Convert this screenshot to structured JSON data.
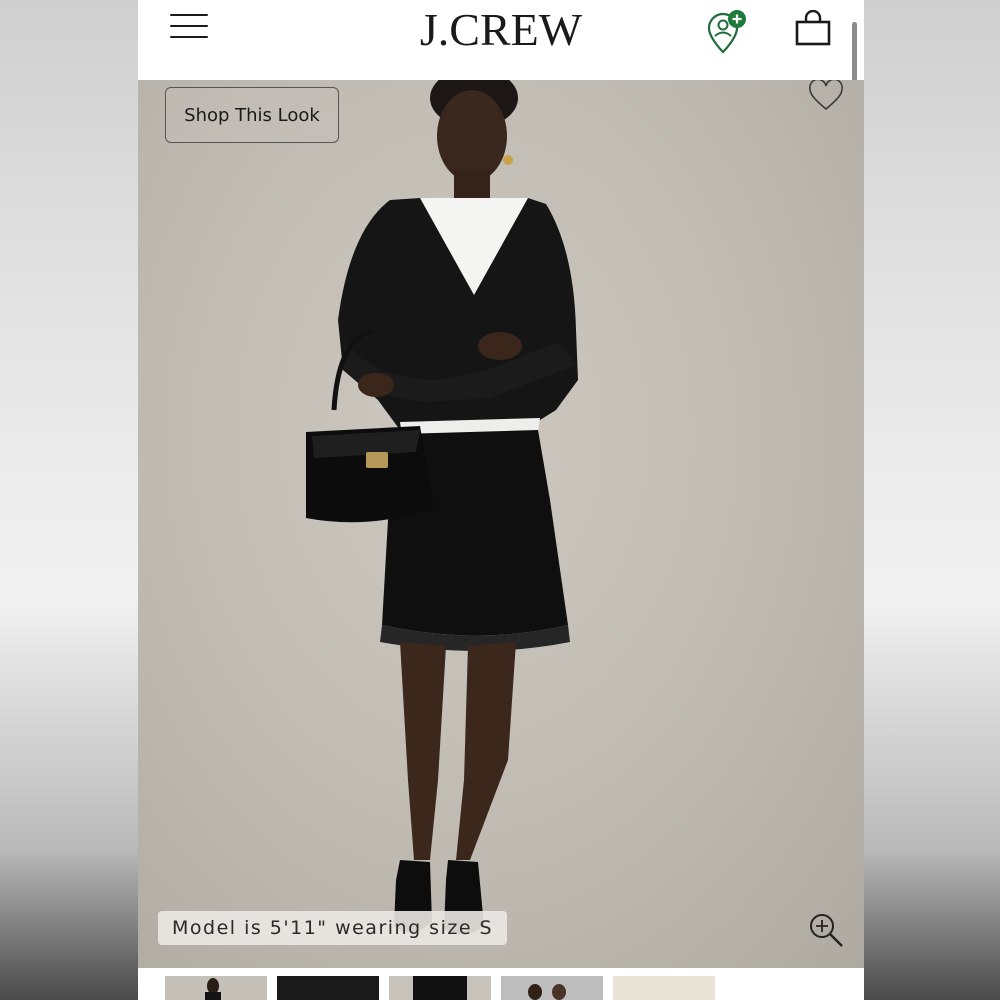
{
  "header": {
    "logo_text": "J.CREW",
    "menu_icon": "hamburger-menu-icon",
    "account_icon": "account-add-icon",
    "bag_icon": "shopping-bag-icon",
    "account_badge_color": "#1f7a3a"
  },
  "hero": {
    "shop_look_label": "Shop This Look",
    "wishlist_icon": "heart-outline-icon",
    "model_info": "Model is 5'11\" wearing size S",
    "zoom_icon": "zoom-in-icon"
  },
  "thumbnails": {
    "count": 5
  },
  "colors": {
    "background_photo": "#c2bdb5",
    "text": "#1a1a1a"
  }
}
